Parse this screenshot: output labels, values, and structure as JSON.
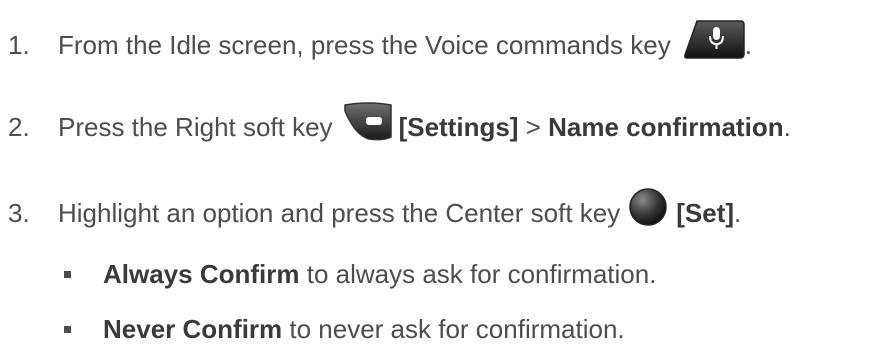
{
  "steps": [
    {
      "number": "1.",
      "text_before": "From the Idle screen, press the Voice commands key",
      "icon": "voice-commands-key-icon",
      "text_after": "."
    },
    {
      "number": "2.",
      "text_before": "Press the Right soft key",
      "icon": "right-soft-key-icon",
      "bold_1": "[Settings]",
      "sep": " > ",
      "bold_2": "Name confirmation",
      "text_after": "."
    },
    {
      "number": "3.",
      "text_before": "Highlight an option and press the Center soft key",
      "icon": "center-soft-key-icon",
      "bold_1": "[Set]",
      "text_after": "."
    }
  ],
  "options": [
    {
      "bold": "Always Confirm",
      "text": " to always ask for confirmation."
    },
    {
      "bold": "Never Confirm",
      "text": " to never ask for confirmation."
    }
  ]
}
